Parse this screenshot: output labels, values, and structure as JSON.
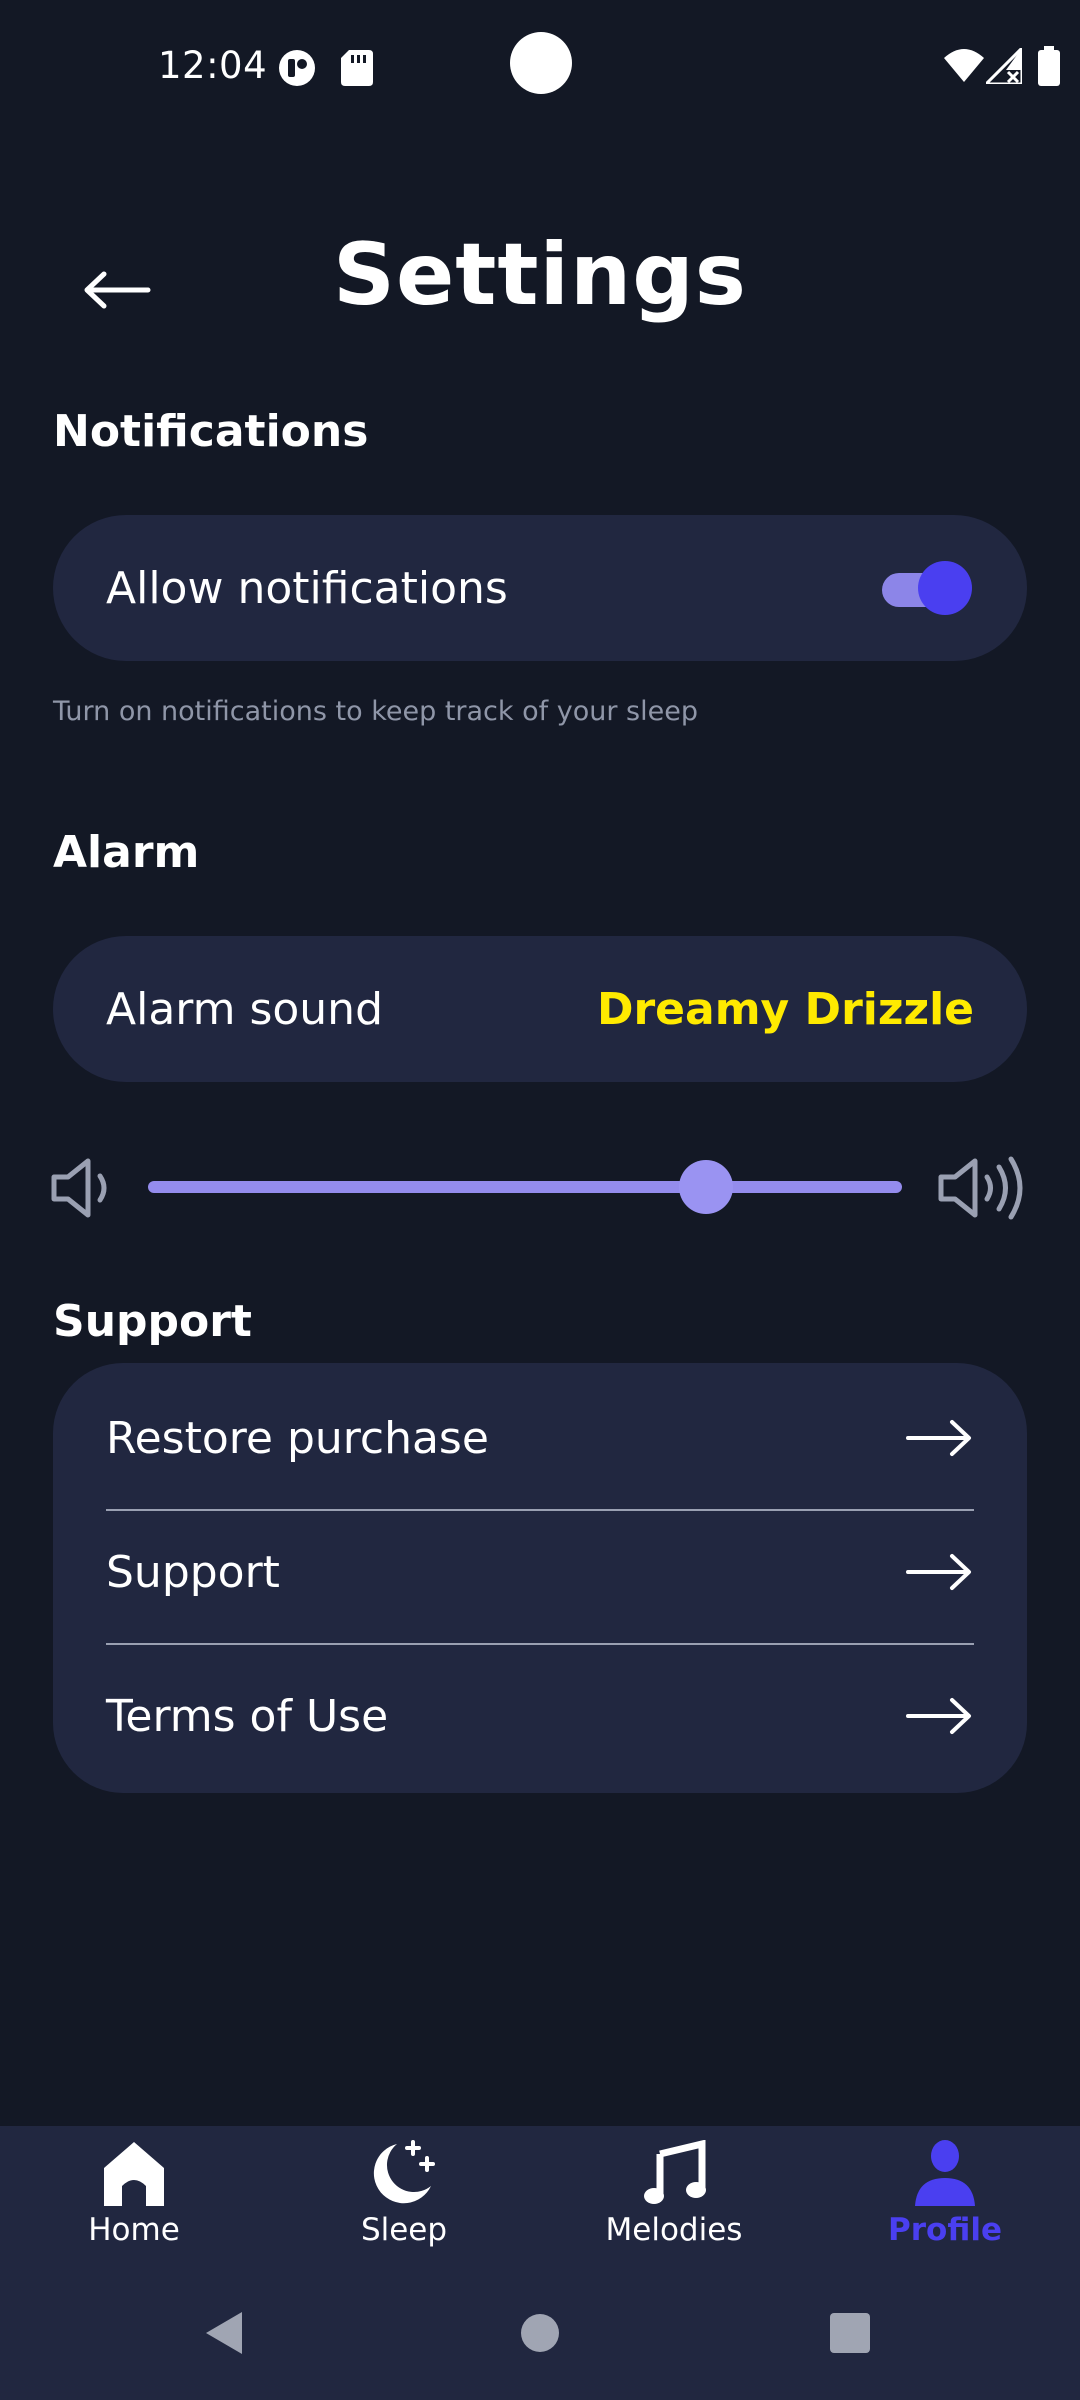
{
  "status_bar": {
    "time": "12:04"
  },
  "header": {
    "title": "Settings"
  },
  "notifications": {
    "section_title": "Notifications",
    "allow_label": "Allow notifications",
    "allow_enabled": true,
    "hint": "Turn on notifications to keep track of your sleep"
  },
  "alarm": {
    "section_title": "Alarm",
    "sound_label": "Alarm sound",
    "sound_value": "Dreamy Drizzle",
    "volume_fraction": 0.74
  },
  "support": {
    "section_title": "Support",
    "items": [
      {
        "label": "Restore purchase"
      },
      {
        "label": "Support"
      },
      {
        "label": "Terms of Use"
      }
    ]
  },
  "bottom_nav": {
    "items": [
      {
        "label": "Home",
        "icon": "home-icon"
      },
      {
        "label": "Sleep",
        "icon": "moon-stars-icon"
      },
      {
        "label": "Melodies",
        "icon": "music-note-icon"
      },
      {
        "label": "Profile",
        "icon": "person-icon",
        "active": true
      }
    ]
  },
  "colors": {
    "background": "#131825",
    "card": "#212740",
    "accent": "#4a3ff0",
    "slider": "#948ced",
    "highlight_text": "#ffea00"
  }
}
